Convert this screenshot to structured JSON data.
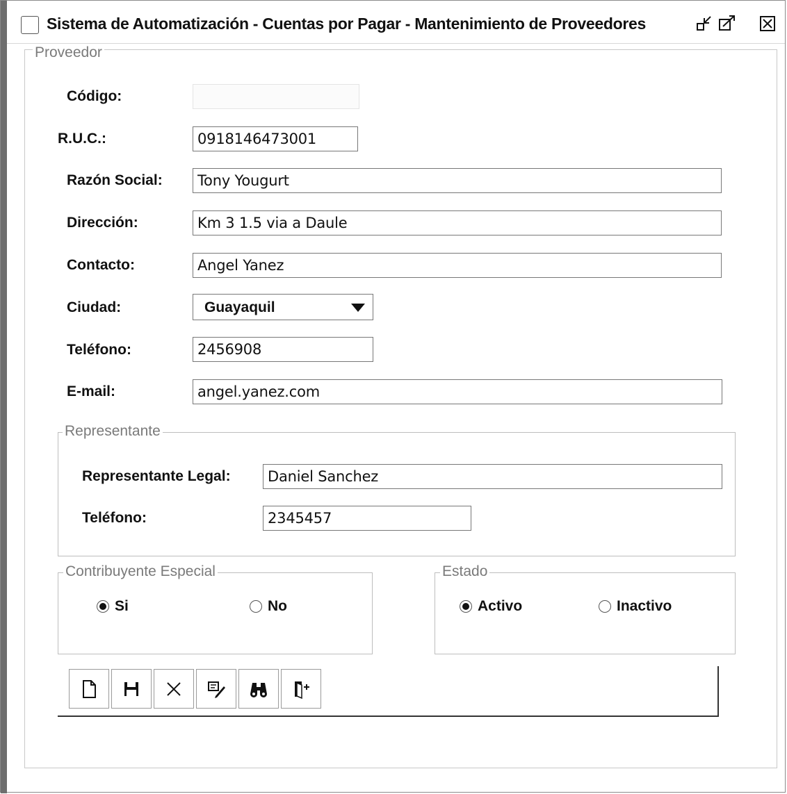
{
  "window": {
    "title": "Sistema de Automatización - Cuentas por Pagar - Mantenimiento de Proveedores"
  },
  "proveedor": {
    "legend": "Proveedor",
    "codigo_label": "Código:",
    "codigo_value": "",
    "ruc_label": "R.U.C.:",
    "ruc_value": "0918146473001",
    "razon_label": "Razón Social:",
    "razon_value": "Tony Yougurt",
    "direccion_label": "Dirección:",
    "direccion_value": "Km 3 1.5 via a Daule",
    "contacto_label": "Contacto:",
    "contacto_value": "Angel Yanez",
    "ciudad_label": "Ciudad:",
    "ciudad_value": "Guayaquil",
    "telefono_label": "Teléfono:",
    "telefono_value": "2456908",
    "email_label": "E-mail:",
    "email_value": "angel.yanez.com"
  },
  "representante": {
    "legend": "Representante",
    "legal_label": "Representante Legal:",
    "legal_value": "Daniel Sanchez",
    "telefono_label": "Teléfono:",
    "telefono_value": "2345457"
  },
  "contribuyente": {
    "legend": "Contribuyente Especial",
    "options": [
      {
        "label": "Si",
        "selected": true
      },
      {
        "label": "No",
        "selected": false
      }
    ]
  },
  "estado": {
    "legend": "Estado",
    "options": [
      {
        "label": "Activo",
        "selected": true
      },
      {
        "label": "Inactivo",
        "selected": false
      }
    ]
  },
  "toolbar": {
    "icons": [
      "new-document-icon",
      "save-icon",
      "delete-icon",
      "edit-icon",
      "search-binoculars-icon",
      "exit-door-icon"
    ]
  }
}
